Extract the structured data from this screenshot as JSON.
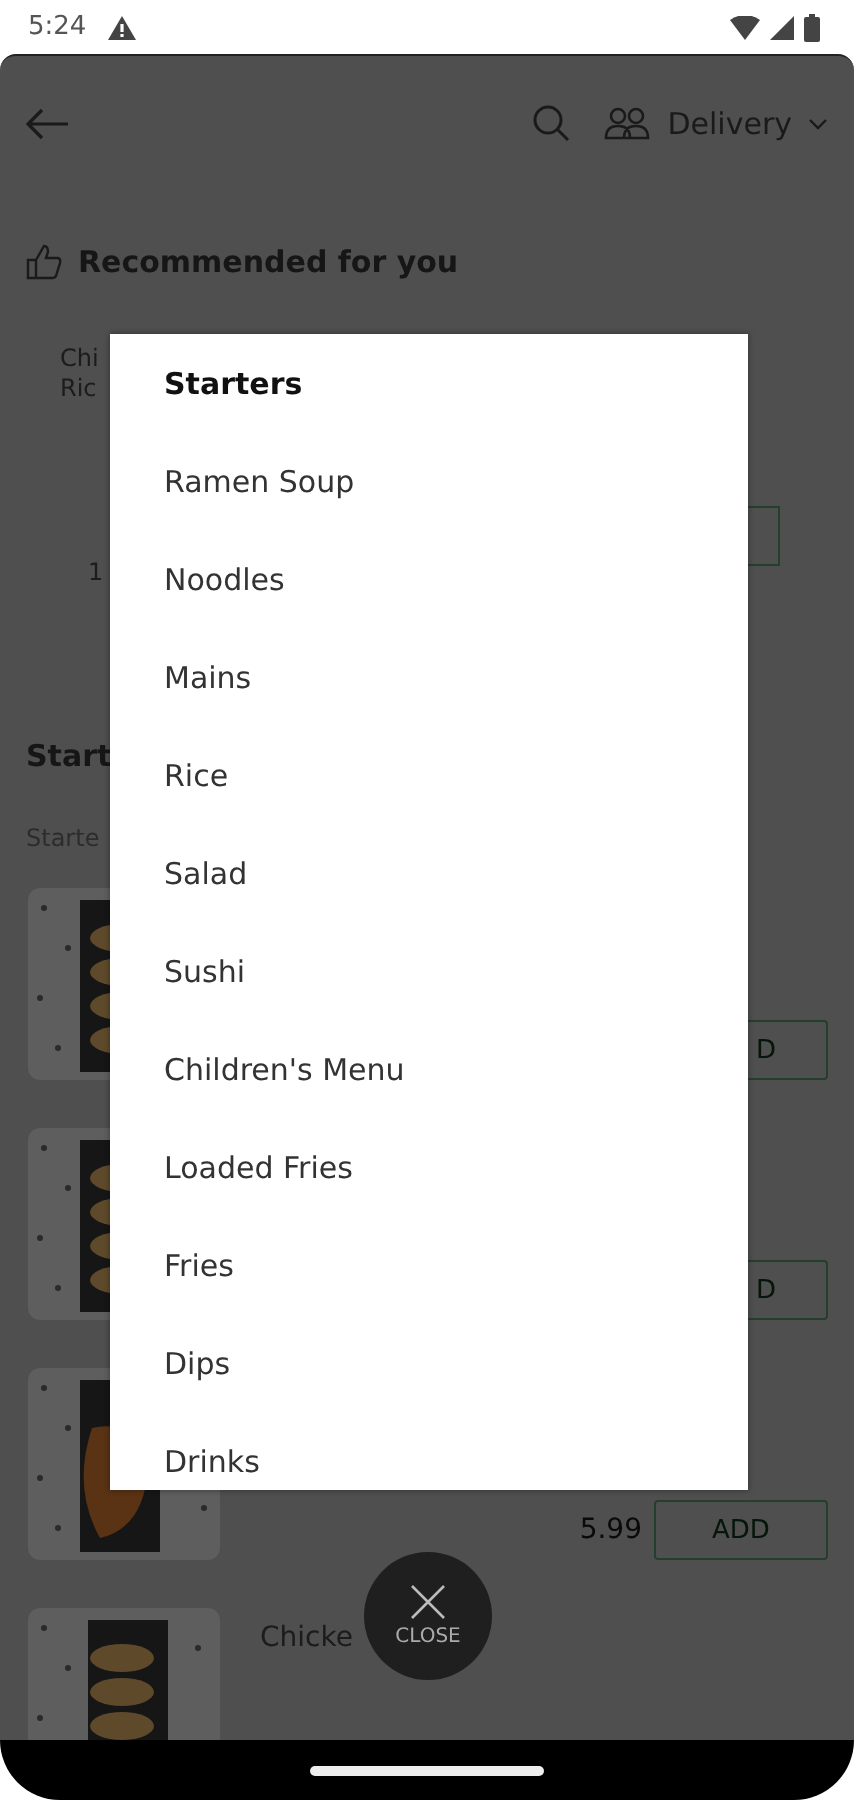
{
  "status_bar": {
    "time": "5:24"
  },
  "header": {
    "delivery_mode": "Delivery"
  },
  "recommended": {
    "title": "Recommended for you",
    "card": {
      "name_lines": [
        "Chi",
        "Ric"
      ],
      "price": "1"
    }
  },
  "section": {
    "title": "Start",
    "subtitle": "Starte"
  },
  "items": [
    {
      "button": "D"
    },
    {
      "button": "D"
    },
    {
      "price": "5.99",
      "button": "ADD"
    },
    {
      "name": "Chicke"
    }
  ],
  "category_menu": {
    "items": [
      {
        "label": "Starters",
        "selected": true
      },
      {
        "label": "Ramen Soup",
        "selected": false
      },
      {
        "label": "Noodles",
        "selected": false
      },
      {
        "label": "Mains",
        "selected": false
      },
      {
        "label": "Rice",
        "selected": false
      },
      {
        "label": "Salad",
        "selected": false
      },
      {
        "label": "Sushi",
        "selected": false
      },
      {
        "label": "Children's Menu",
        "selected": false
      },
      {
        "label": "Loaded Fries",
        "selected": false
      },
      {
        "label": "Fries",
        "selected": false
      },
      {
        "label": "Dips",
        "selected": false
      },
      {
        "label": "Drinks",
        "selected": false
      }
    ]
  },
  "close_button": {
    "label": "CLOSE"
  }
}
